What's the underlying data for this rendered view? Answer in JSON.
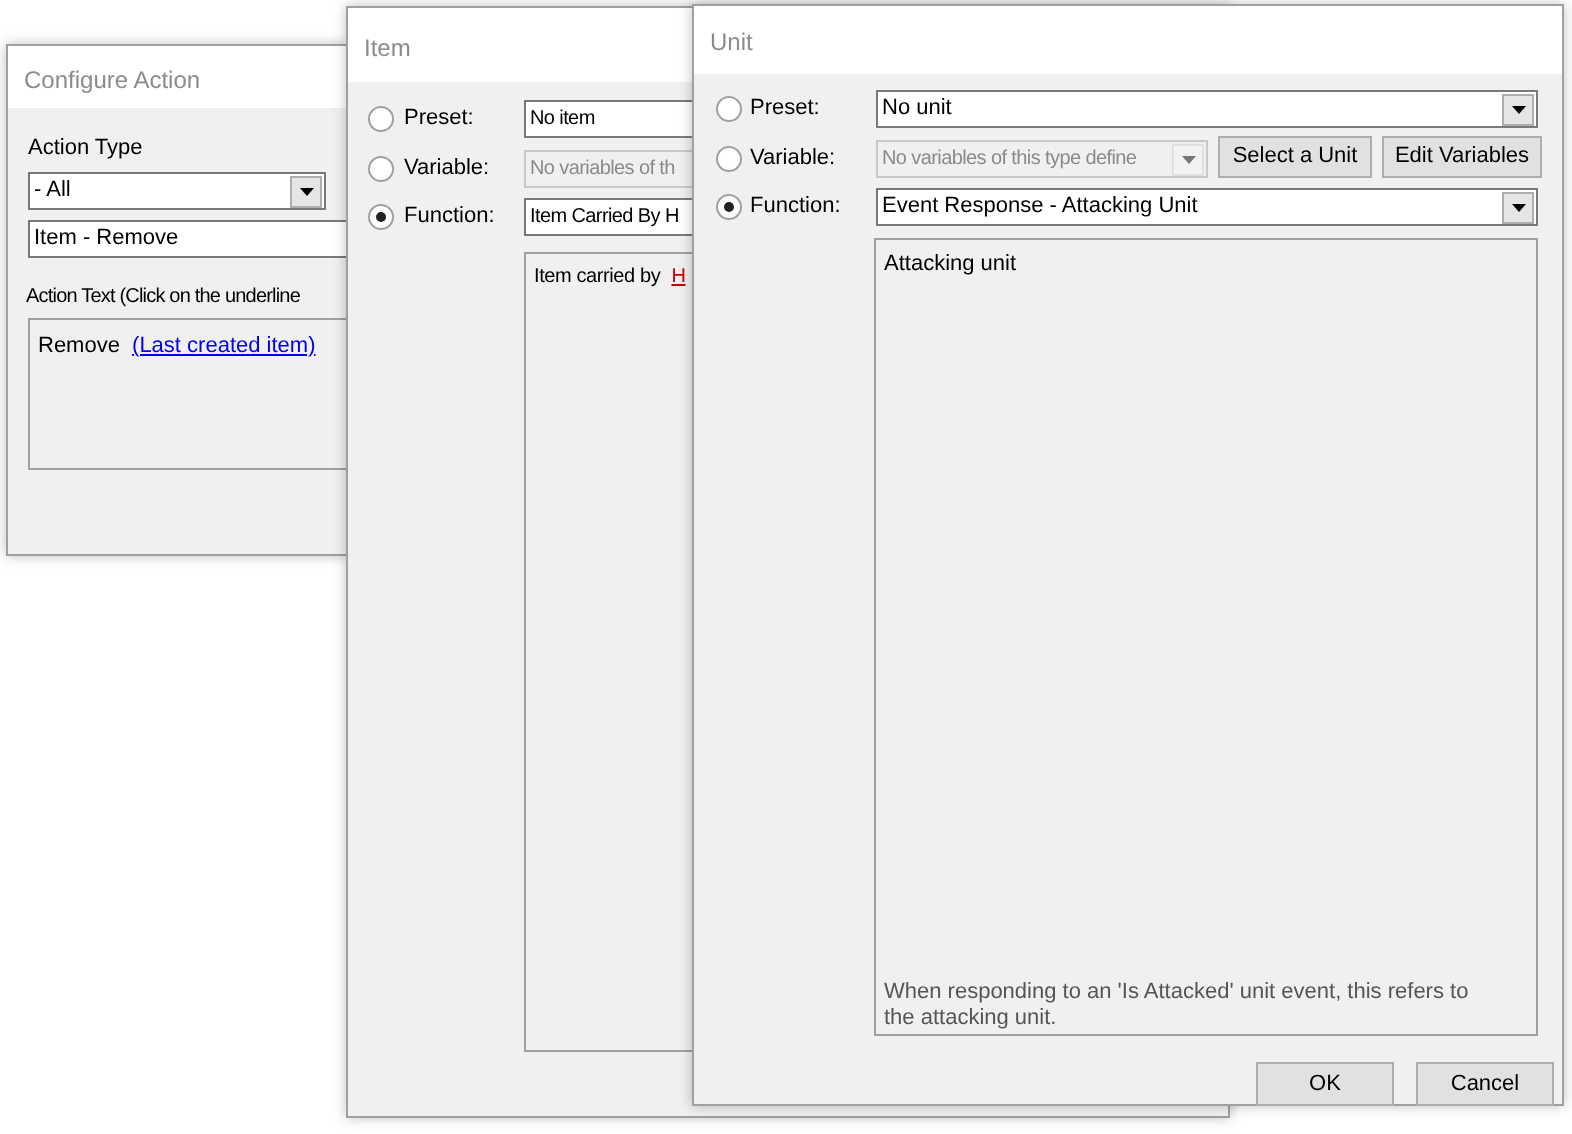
{
  "configure_action": {
    "title": "Configure Action",
    "action_type_label": "Action Type",
    "category": {
      "value": "- All"
    },
    "action": {
      "value": "Item - Remove"
    },
    "action_text_label": "Action Text (Click on the underline",
    "action_text": {
      "prefix": "Remove",
      "link": "(Last created item)"
    }
  },
  "item_dialog": {
    "title": "Item",
    "options": [
      {
        "label": "Preset:",
        "selected": false,
        "value": "No item",
        "disabled": false
      },
      {
        "label": "Variable:",
        "selected": false,
        "value": "No variables of th",
        "disabled": true
      },
      {
        "label": "Function:",
        "selected": true,
        "value": "Item Carried By H",
        "disabled": false
      }
    ],
    "description": {
      "prefix": "Item carried by",
      "link": "H"
    }
  },
  "unit_dialog": {
    "title": "Unit",
    "options": [
      {
        "label": "Preset:",
        "selected": false,
        "value": "No unit",
        "disabled": false
      },
      {
        "label": "Variable:",
        "selected": false,
        "value": "No variables of this type define",
        "disabled": true
      },
      {
        "label": "Function:",
        "selected": true,
        "value": "Event Response - Attacking Unit",
        "disabled": false
      }
    ],
    "variable_buttons": [
      "Select a Unit",
      "Edit Variables"
    ],
    "description": {
      "heading": "Attacking unit",
      "note": "When responding to an 'Is Attacked' unit event, this refers to the attacking unit."
    },
    "buttons": [
      "OK",
      "Cancel"
    ]
  }
}
